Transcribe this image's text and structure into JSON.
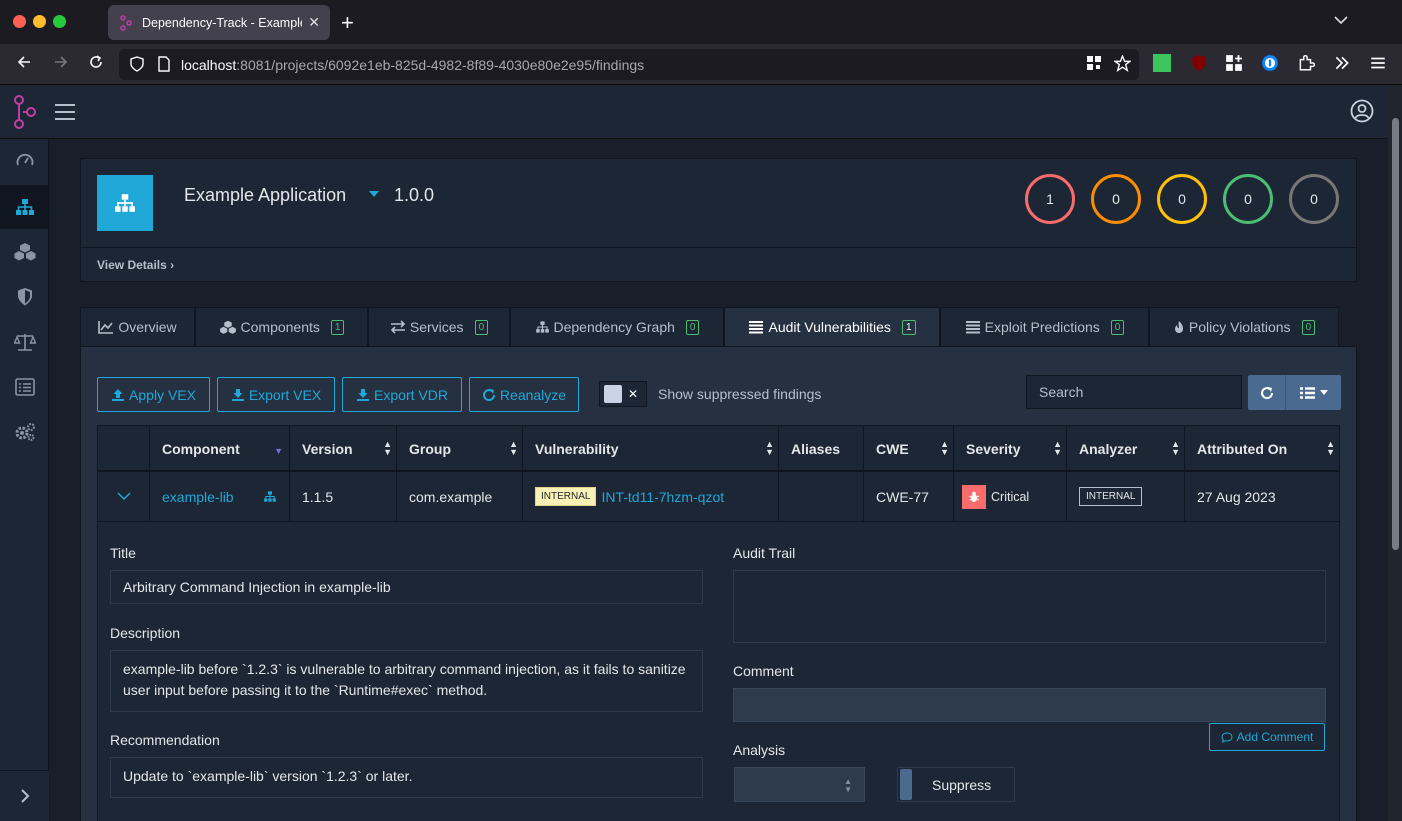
{
  "browser": {
    "tab_title": "Dependency-Track - Example Ap",
    "url_host": "localhost",
    "url_rest": ":8081/projects/6092e1eb-825d-4982-8f89-4030e80e2e95/findings"
  },
  "project": {
    "name": "Example Application",
    "version": "1.0.0",
    "view_details": "View Details",
    "severity_counts": [
      {
        "label": "critical",
        "value": "1",
        "color": "#f86c6b"
      },
      {
        "label": "high",
        "value": "0",
        "color": "#fd8c00"
      },
      {
        "label": "medium",
        "value": "0",
        "color": "#ffc107"
      },
      {
        "label": "low",
        "value": "0",
        "color": "#4dbd74"
      },
      {
        "label": "unassigned",
        "value": "0",
        "color": "#777777"
      }
    ]
  },
  "tabs": [
    {
      "label": "Overview",
      "badge": ""
    },
    {
      "label": "Components",
      "badge": "1"
    },
    {
      "label": "Services",
      "badge": "0"
    },
    {
      "label": "Dependency Graph",
      "badge": "0"
    },
    {
      "label": "Audit Vulnerabilities",
      "badge": "1"
    },
    {
      "label": "Exploit Predictions",
      "badge": "0"
    },
    {
      "label": "Policy Violations",
      "badge": "0"
    }
  ],
  "toolbar": {
    "apply_vex": "Apply VEX",
    "export_vex": "Export VEX",
    "export_vdr": "Export VDR",
    "reanalyze": "Reanalyze",
    "show_suppressed": "Show suppressed findings",
    "search_placeholder": "Search"
  },
  "table": {
    "headers": [
      "Component",
      "Version",
      "Group",
      "Vulnerability",
      "Aliases",
      "CWE",
      "Severity",
      "Analyzer",
      "Attributed On"
    ],
    "row": {
      "component": "example-lib",
      "version": "1.1.5",
      "group": "com.example",
      "vuln_source": "INTERNAL",
      "vuln_id": "INT-td11-7hzm-qzot",
      "aliases": "",
      "cwe": "CWE-77",
      "severity": "Critical",
      "analyzer": "INTERNAL",
      "attributed_on": "27 Aug 2023"
    }
  },
  "details": {
    "title_label": "Title",
    "title_value": "Arbitrary Command Injection in example-lib",
    "description_label": "Description",
    "description_value": "example-lib before `1.2.3` is vulnerable to arbitrary command injection, as it fails to sanitize user input before passing it to the `Runtime#exec` method.",
    "recommendation_label": "Recommendation",
    "recommendation_value": "Update to `example-lib` version `1.2.3` or later.",
    "audit_trail_label": "Audit Trail",
    "comment_label": "Comment",
    "add_comment": "Add Comment",
    "analysis_label": "Analysis",
    "suppress": "Suppress"
  }
}
